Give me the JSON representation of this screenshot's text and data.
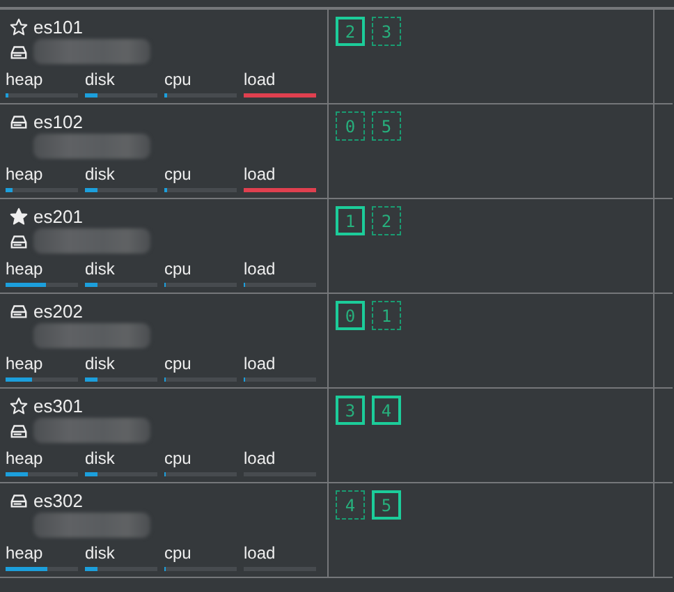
{
  "nodes": [
    {
      "name": "es101",
      "kind": "eligible",
      "meters": [
        {
          "label": "heap",
          "level": 0.03,
          "color": "#1c9fdc"
        },
        {
          "label": "disk",
          "level": 0.18,
          "color": "#1c9fdc"
        },
        {
          "label": "cpu",
          "level": 0.03,
          "color": "#1c9fdc"
        },
        {
          "label": "load",
          "level": 1,
          "color": "#e0404f"
        }
      ],
      "shards": [
        {
          "number": "2",
          "primary": true
        },
        {
          "number": "3",
          "primary": false
        }
      ]
    },
    {
      "name": "es102",
      "kind": "data",
      "meters": [
        {
          "label": "heap",
          "level": 0.1,
          "color": "#1c9fdc"
        },
        {
          "label": "disk",
          "level": 0.18,
          "color": "#1c9fdc"
        },
        {
          "label": "cpu",
          "level": 0.03,
          "color": "#1c9fdc"
        },
        {
          "label": "load",
          "level": 1,
          "color": "#e0404f"
        }
      ],
      "shards": [
        {
          "number": "0",
          "primary": false
        },
        {
          "number": "5",
          "primary": false
        }
      ]
    },
    {
      "name": "es201",
      "kind": "master",
      "meters": [
        {
          "label": "heap",
          "level": 0.55,
          "color": "#1c9fdc"
        },
        {
          "label": "disk",
          "level": 0.18,
          "color": "#1c9fdc"
        },
        {
          "label": "cpu",
          "level": 0.02,
          "color": "#1c9fdc"
        },
        {
          "label": "load",
          "level": 0.02,
          "color": "#1c9fdc"
        }
      ],
      "shards": [
        {
          "number": "1",
          "primary": true
        },
        {
          "number": "2",
          "primary": false
        }
      ]
    },
    {
      "name": "es202",
      "kind": "data",
      "meters": [
        {
          "label": "heap",
          "level": 0.37,
          "color": "#1c9fdc"
        },
        {
          "label": "disk",
          "level": 0.18,
          "color": "#1c9fdc"
        },
        {
          "label": "cpu",
          "level": 0.02,
          "color": "#1c9fdc"
        },
        {
          "label": "load",
          "level": 0.02,
          "color": "#1c9fdc"
        }
      ],
      "shards": [
        {
          "number": "0",
          "primary": true
        },
        {
          "number": "1",
          "primary": false
        }
      ]
    },
    {
      "name": "es301",
      "kind": "eligible",
      "meters": [
        {
          "label": "heap",
          "level": 0.3,
          "color": "#1c9fdc"
        },
        {
          "label": "disk",
          "level": 0.18,
          "color": "#1c9fdc"
        },
        {
          "label": "cpu",
          "level": 0.02,
          "color": "#1c9fdc"
        },
        {
          "label": "load"
        }
      ],
      "shards": [
        {
          "number": "3",
          "primary": true
        },
        {
          "number": "4",
          "primary": true
        }
      ]
    },
    {
      "name": "es302",
      "kind": "data",
      "meters": [
        {
          "label": "heap",
          "level": 0.57,
          "color": "#1c9fdc"
        },
        {
          "label": "disk",
          "level": 0.18,
          "color": "#1c9fdc"
        },
        {
          "label": "cpu",
          "level": 0.02,
          "color": "#1c9fdc"
        },
        {
          "label": "load"
        }
      ],
      "shards": [
        {
          "number": "4",
          "primary": false
        },
        {
          "number": "5",
          "primary": true
        }
      ]
    }
  ]
}
